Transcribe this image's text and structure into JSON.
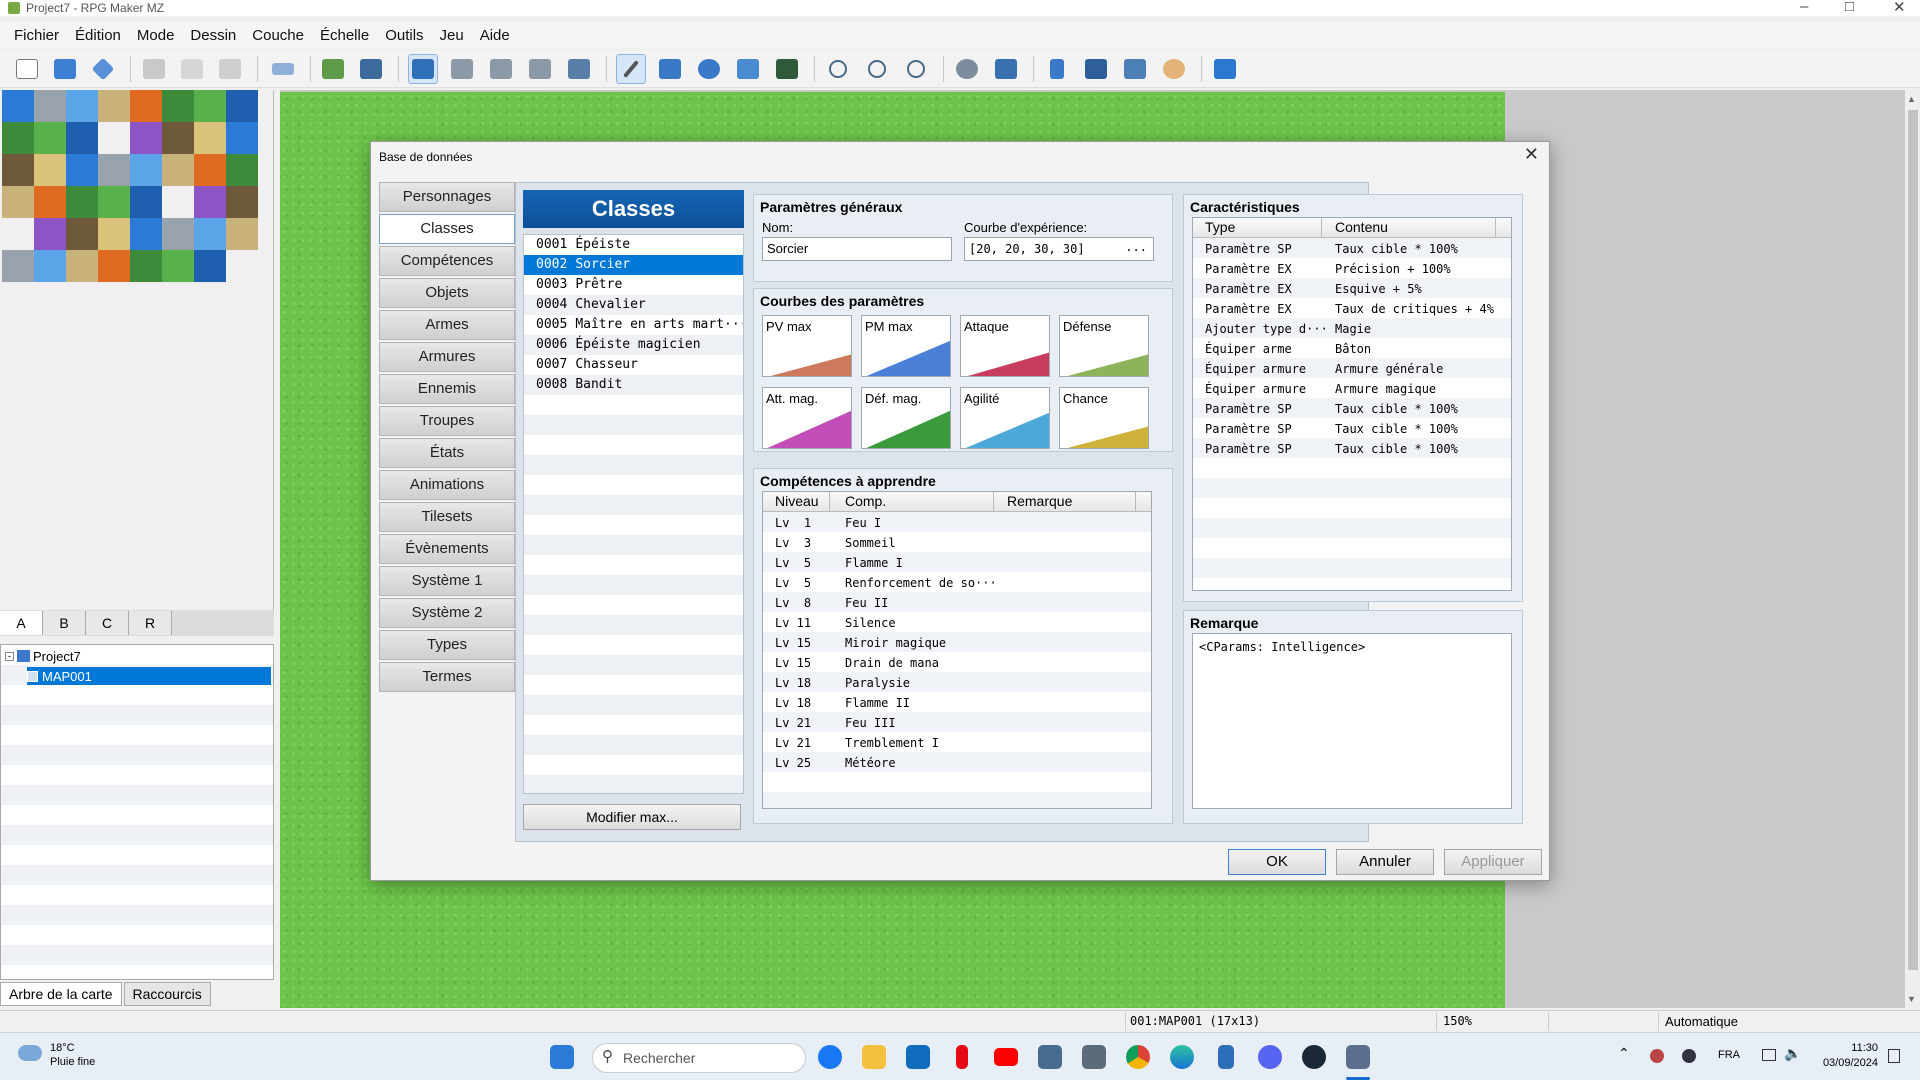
{
  "window": {
    "title": "Project7 - RPG Maker MZ"
  },
  "menu": [
    "Fichier",
    "Édition",
    "Mode",
    "Dessin",
    "Couche",
    "Échelle",
    "Outils",
    "Jeu",
    "Aide"
  ],
  "toolbar": {
    "icons": [
      "new-project-icon",
      "open-project-icon",
      "save-project-icon",
      "cut-icon",
      "copy-icon",
      "paste-icon",
      "undo-icon",
      "map-mode-icon",
      "event-mode-icon",
      "layer1-icon",
      "layer2-icon",
      "layer3-icon",
      "layer4-icon",
      "all-layers-icon",
      "pencil-icon",
      "rectangle-icon",
      "ellipse-icon",
      "fill-icon",
      "shadow-pen-icon",
      "zoom-in-icon",
      "zoom-out-icon",
      "zoom-actual-icon",
      "database-icon",
      "plugin-manager-icon",
      "sound-test-icon",
      "event-searcher-icon",
      "resource-manager-icon",
      "character-generator-icon",
      "playtest-icon"
    ],
    "selected": [
      "layer1-icon",
      "pencil-icon"
    ]
  },
  "tile_tabs": [
    "A",
    "B",
    "C",
    "R"
  ],
  "map_tree": {
    "project": "Project7",
    "map": "MAP001"
  },
  "bottom_tabs": [
    "Arbre de la carte",
    "Raccourcis"
  ],
  "status": {
    "map": "001:MAP001 (17x13)",
    "zoom": "150%",
    "mode": "Automatique"
  },
  "taskbar": {
    "temperature": "18°C",
    "weather": "Pluie fine",
    "search_placeholder": "Rechercher",
    "lang": "FRA",
    "time": "11:30",
    "date": "03/09/2024",
    "apps": [
      "facebook-icon",
      "file-explorer-icon",
      "outlook-icon",
      "netflix-icon",
      "youtube-icon",
      "taskbar-app-icon",
      "calculator-icon",
      "chrome-icon",
      "edge-icon",
      "notepad-icon",
      "discord-icon",
      "steam-icon",
      "rpg-maker-icon"
    ]
  },
  "dialog": {
    "title": "Base de données",
    "categories": [
      "Personnages",
      "Classes",
      "Compétences",
      "Objets",
      "Armes",
      "Armures",
      "Ennemis",
      "Troupes",
      "États",
      "Animations",
      "Tilesets",
      "Évènements",
      "Système 1",
      "Système 2",
      "Types",
      "Termes"
    ],
    "active_category": "Classes",
    "list_header": "Classes",
    "classes": [
      {
        "id": "0001",
        "name": "Épéiste"
      },
      {
        "id": "0002",
        "name": "Sorcier"
      },
      {
        "id": "0003",
        "name": "Prêtre"
      },
      {
        "id": "0004",
        "name": "Chevalier"
      },
      {
        "id": "0005",
        "name": "Maître en arts mart···"
      },
      {
        "id": "0006",
        "name": "Épéiste magicien"
      },
      {
        "id": "0007",
        "name": "Chasseur"
      },
      {
        "id": "0008",
        "name": "Bandit"
      }
    ],
    "selected_class": "0002",
    "modify_max": "Modifier max...",
    "general": {
      "title": "Paramètres généraux",
      "name_label": "Nom:",
      "name_value": "Sorcier",
      "exp_label": "Courbe d'expérience:",
      "exp_value": "[20, 20, 30, 30]",
      "exp_button": "..."
    },
    "curves": {
      "title": "Courbes des paramètres",
      "items": [
        {
          "label": "PV max",
          "color": "#cd7a5c"
        },
        {
          "label": "PM max",
          "color": "#4a80d8"
        },
        {
          "label": "Attaque",
          "color": "#c83c5c"
        },
        {
          "label": "Défense",
          "color": "#8fb35a"
        },
        {
          "label": "Att. mag.",
          "color": "#c24cb8"
        },
        {
          "label": "Déf. mag.",
          "color": "#3a9a3c"
        },
        {
          "label": "Agilité",
          "color": "#4ba8d8"
        },
        {
          "label": "Chance",
          "color": "#cfb23c"
        }
      ]
    },
    "skills": {
      "title": "Compétences à apprendre",
      "columns": [
        "Niveau",
        "Comp.",
        "Remarque"
      ],
      "rows": [
        {
          "level": "Lv  1",
          "skill": "Feu I"
        },
        {
          "level": "Lv  3",
          "skill": "Sommeil"
        },
        {
          "level": "Lv  5",
          "skill": "Flamme I"
        },
        {
          "level": "Lv  5",
          "skill": "Renforcement de so···"
        },
        {
          "level": "Lv  8",
          "skill": "Feu II"
        },
        {
          "level": "Lv 11",
          "skill": "Silence"
        },
        {
          "level": "Lv 15",
          "skill": "Miroir magique"
        },
        {
          "level": "Lv 15",
          "skill": "Drain de mana"
        },
        {
          "level": "Lv 18",
          "skill": "Paralysie"
        },
        {
          "level": "Lv 18",
          "skill": "Flamme II"
        },
        {
          "level": "Lv 21",
          "skill": "Feu III"
        },
        {
          "level": "Lv 21",
          "skill": "Tremblement I"
        },
        {
          "level": "Lv 25",
          "skill": "Météore"
        }
      ]
    },
    "traits": {
      "title": "Caractéristiques",
      "columns": [
        "Type",
        "Contenu"
      ],
      "rows": [
        {
          "type": "Paramètre SP",
          "content": "Taux cible * 100%"
        },
        {
          "type": "Paramètre EX",
          "content": "Précision + 100%"
        },
        {
          "type": "Paramètre EX",
          "content": "Esquive + 5%"
        },
        {
          "type": "Paramètre EX",
          "content": "Taux de critiques + 4%"
        },
        {
          "type": "Ajouter type d···",
          "content": "Magie"
        },
        {
          "type": "Équiper arme",
          "content": "Bâton"
        },
        {
          "type": "Équiper armure",
          "content": "Armure générale"
        },
        {
          "type": "Équiper armure",
          "content": "Armure magique"
        },
        {
          "type": "Paramètre SP",
          "content": "Taux cible * 100%"
        },
        {
          "type": "Paramètre SP",
          "content": "Taux cible * 100%"
        },
        {
          "type": "Paramètre SP",
          "content": "Taux cible * 100%"
        }
      ]
    },
    "note": {
      "title": "Remarque",
      "value": "<CParams: Intelligence>"
    },
    "buttons": {
      "ok": "OK",
      "cancel": "Annuler",
      "apply": "Appliquer"
    }
  }
}
